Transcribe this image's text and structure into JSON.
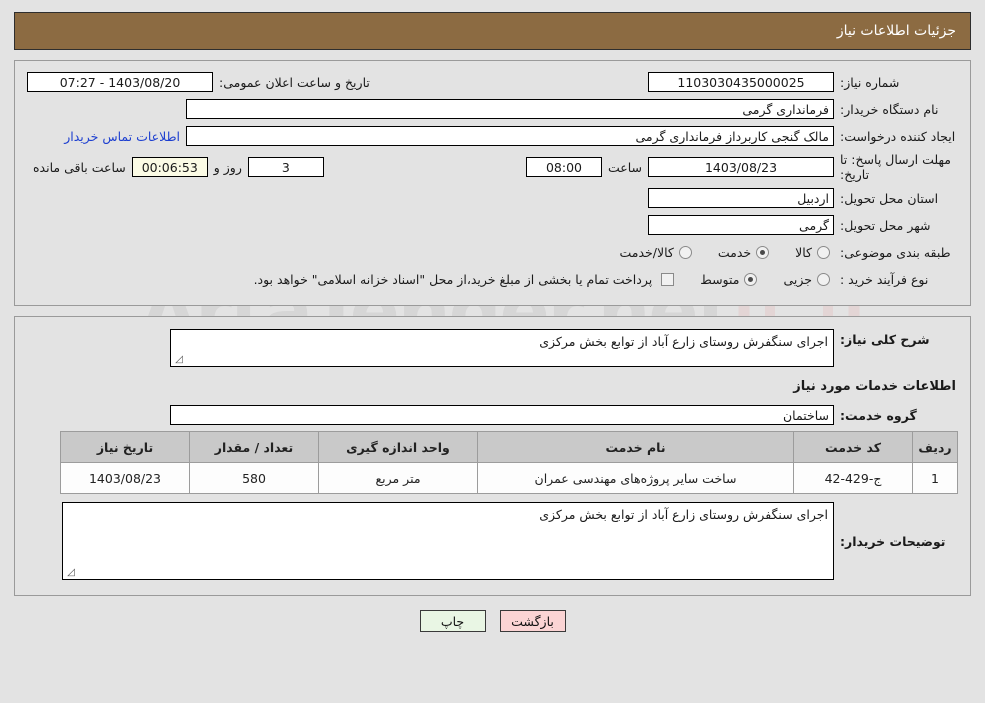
{
  "header": {
    "title": "جزئیات اطلاعات نیاز"
  },
  "form": {
    "need_number_label": "شماره نیاز:",
    "need_number_value": "1103030435000025",
    "public_announce_label": "تاریخ و ساعت اعلان عمومی:",
    "public_announce_value": "1403/08/20 - 07:27",
    "buyer_org_label": "نام دستگاه خریدار:",
    "buyer_org_value": "فرمانداری گرمی",
    "creator_label": "ایجاد کننده درخواست:",
    "creator_value": "مالک گنجی کاربرداز فرمانداری گرمی",
    "buyer_contact_link": "اطلاعات تماس خریدار",
    "deadline_label": "مهلت ارسال پاسخ: تا تاریخ:",
    "deadline_date": "1403/08/23",
    "hour_label": "ساعت",
    "deadline_time": "08:00",
    "days_value": "3",
    "days_and_label": "روز و",
    "remaining_time": "00:06:53",
    "remaining_label": "ساعت باقی مانده",
    "province_label": "استان محل تحویل:",
    "province_value": "اردبیل",
    "city_label": "شهر محل تحویل:",
    "city_value": "گرمی",
    "category_label": "طبقه بندی موضوعی:",
    "category_options": [
      {
        "label": "کالا",
        "selected": false
      },
      {
        "label": "خدمت",
        "selected": true
      },
      {
        "label": "کالا/خدمت",
        "selected": false
      }
    ],
    "process_label": "نوع فرآیند خرید :",
    "process_options": [
      {
        "label": "جزیی",
        "selected": false
      },
      {
        "label": "متوسط",
        "selected": true
      }
    ],
    "treasury_checkbox_checked": false,
    "treasury_note": "پرداخت تمام یا بخشی از مبلغ خرید،از محل \"اسناد خزانه اسلامی\" خواهد بود."
  },
  "detail": {
    "general_desc_label": "شرح کلی نیاز:",
    "general_desc_value": "اجرای سنگفرش روستای زارع آباد از توابع بخش مرکزی",
    "services_heading": "اطلاعات خدمات مورد نیاز",
    "service_group_label": "گروه خدمت:",
    "service_group_value": "ساختمان",
    "table": {
      "columns": [
        "ردیف",
        "کد خدمت",
        "نام خدمت",
        "واحد اندازه گیری",
        "تعداد / مقدار",
        "تاریخ نیاز"
      ],
      "rows": [
        {
          "row": "1",
          "code": "ج-429-42",
          "name": "ساخت سایر پروژه‌های مهندسی عمران",
          "unit": "متر مربع",
          "quantity": "580",
          "need_date": "1403/08/23"
        }
      ]
    },
    "buyer_notes_label": "توضیحات خریدار:",
    "buyer_notes_value": "اجرای سنگفرش روستای زارع آباد از توابع بخش مرکزی"
  },
  "footer": {
    "back_button": "بازگشت",
    "print_button": "چاپ"
  },
  "watermark": {
    "text": "ArtaTender.net"
  }
}
